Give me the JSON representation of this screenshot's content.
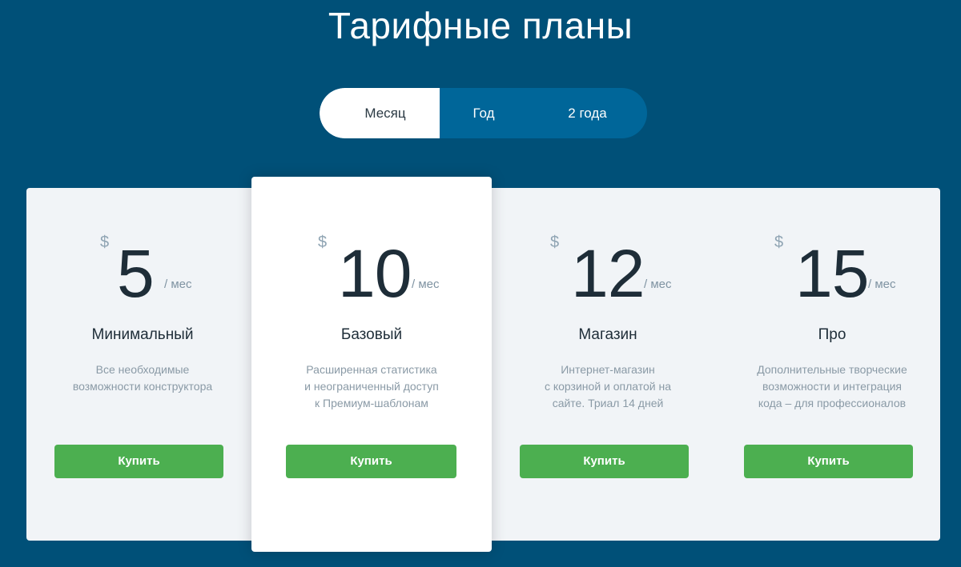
{
  "header": {
    "title": "Тарифные планы"
  },
  "period_switch": {
    "tabs": [
      {
        "label": "Месяц",
        "active": true
      },
      {
        "label": "Год",
        "active": false
      },
      {
        "label": "2 года",
        "active": false
      }
    ]
  },
  "plans": [
    {
      "currency": "$",
      "price": "5",
      "period": "/ мес",
      "name": "Минимальный",
      "description": [
        "Все необходимые",
        "возможности конструктора"
      ],
      "button": "Купить",
      "featured": false
    },
    {
      "currency": "$",
      "price": "10",
      "period": "/ мес",
      "name": "Базовый",
      "description": [
        "Расширенная статистика",
        "и неограниченный доступ",
        "к Премиум-шаблонам"
      ],
      "button": "Купить",
      "featured": true
    },
    {
      "currency": "$",
      "price": "12",
      "period": "/ мес",
      "name": "Магазин",
      "description": [
        "Интернет-магазин",
        "с корзиной и оплатой на",
        "сайте. Триал 14 дней"
      ],
      "button": "Купить",
      "featured": false
    },
    {
      "currency": "$",
      "price": "15",
      "period": "/ мес",
      "name": "Про",
      "description": [
        "Дополнительные творческие",
        "возможности и интеграция",
        "кода – для профессионалов"
      ],
      "button": "Купить",
      "featured": false
    }
  ],
  "colors": {
    "background": "#005078",
    "switch_background": "#006699",
    "panel_background": "#f1f4f7",
    "buy_button": "#4caf50"
  }
}
